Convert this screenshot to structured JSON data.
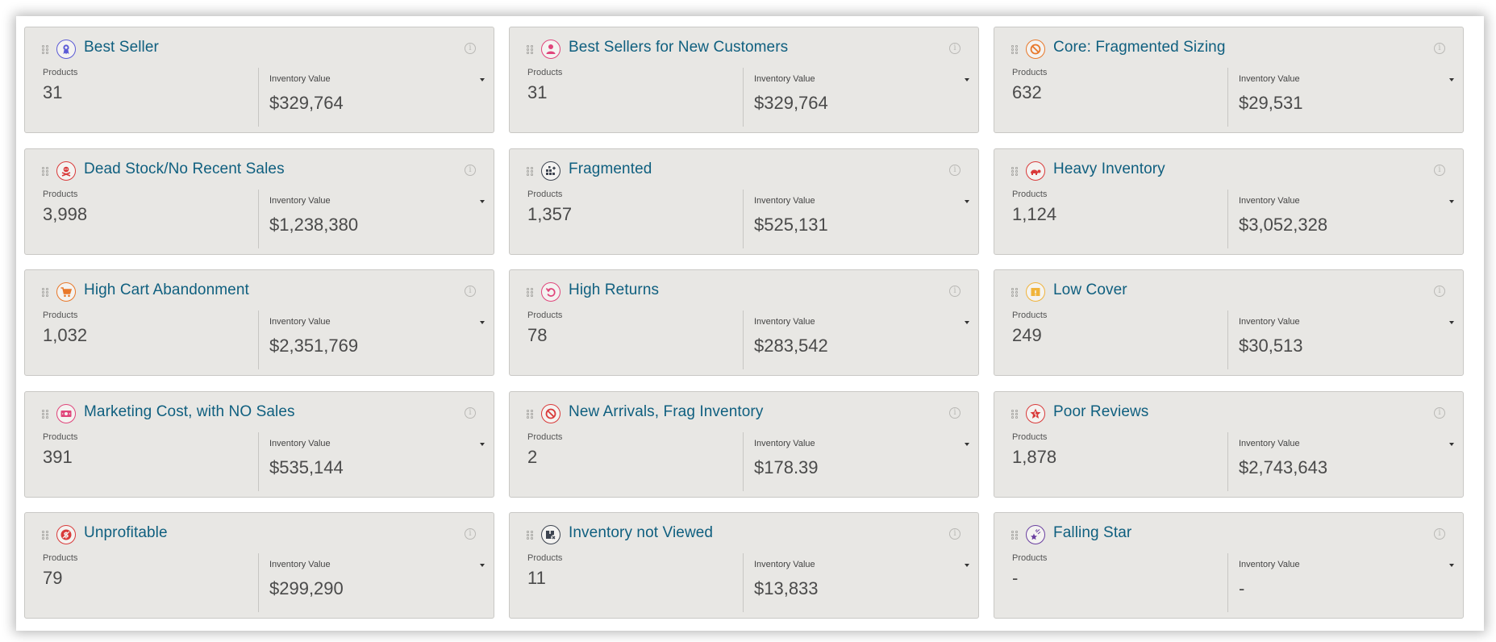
{
  "labels": {
    "products": "Products",
    "inventory_value": "Inventory Value",
    "info_glyph": "i"
  },
  "cards": [
    {
      "title": "Best Seller",
      "icon": "award-ribbon-icon",
      "icon_color": "#5b5bd6",
      "products": "31",
      "inventory_value": "$329,764"
    },
    {
      "title": "Best Sellers for New Customers",
      "icon": "user-icon",
      "icon_color": "#e0457b",
      "products": "31",
      "inventory_value": "$329,764"
    },
    {
      "title": "Core: Fragmented Sizing",
      "icon": "prohibited-icon",
      "icon_color": "#e8782a",
      "products": "632",
      "inventory_value": "$29,531"
    },
    {
      "title": "Dead Stock/No Recent Sales",
      "icon": "skull-crossbones-icon",
      "icon_color": "#d93a3a",
      "products": "3,998",
      "inventory_value": "$1,238,380"
    },
    {
      "title": "Fragmented",
      "icon": "fragmented-blocks-icon",
      "icon_color": "#3d4450",
      "products": "1,357",
      "inventory_value": "$525,131"
    },
    {
      "title": "Heavy Inventory",
      "icon": "turtle-icon",
      "icon_color": "#d93a3a",
      "products": "1,124",
      "inventory_value": "$3,052,328"
    },
    {
      "title": "High Cart Abandonment",
      "icon": "shopping-cart-icon",
      "icon_color": "#e8782a",
      "products": "1,032",
      "inventory_value": "$2,351,769"
    },
    {
      "title": "High Returns",
      "icon": "return-arrow-icon",
      "icon_color": "#e0457b",
      "products": "78",
      "inventory_value": "$283,542"
    },
    {
      "title": "Low Cover",
      "icon": "box-alert-icon",
      "icon_color": "#f0b43c",
      "products": "249",
      "inventory_value": "$30,513"
    },
    {
      "title": "Marketing Cost, with NO Sales",
      "icon": "cash-icon",
      "icon_color": "#e0457b",
      "products": "391",
      "inventory_value": "$535,144"
    },
    {
      "title": "New Arrivals, Frag Inventory",
      "icon": "prohibited-icon",
      "icon_color": "#d93a3a",
      "products": "2",
      "inventory_value": "$178.39"
    },
    {
      "title": "Poor Reviews",
      "icon": "broken-star-icon",
      "icon_color": "#d93a3a",
      "products": "1,878",
      "inventory_value": "$2,743,643"
    },
    {
      "title": "Unprofitable",
      "icon": "no-dollar-icon",
      "icon_color": "#d93a3a",
      "products": "79",
      "inventory_value": "$299,290"
    },
    {
      "title": "Inventory not Viewed",
      "icon": "box-x-icon",
      "icon_color": "#3d4450",
      "products": "11",
      "inventory_value": "$13,833"
    },
    {
      "title": "Falling Star",
      "icon": "falling-star-icon",
      "icon_color": "#6a3fa0",
      "products": "-",
      "inventory_value": "-"
    }
  ]
}
